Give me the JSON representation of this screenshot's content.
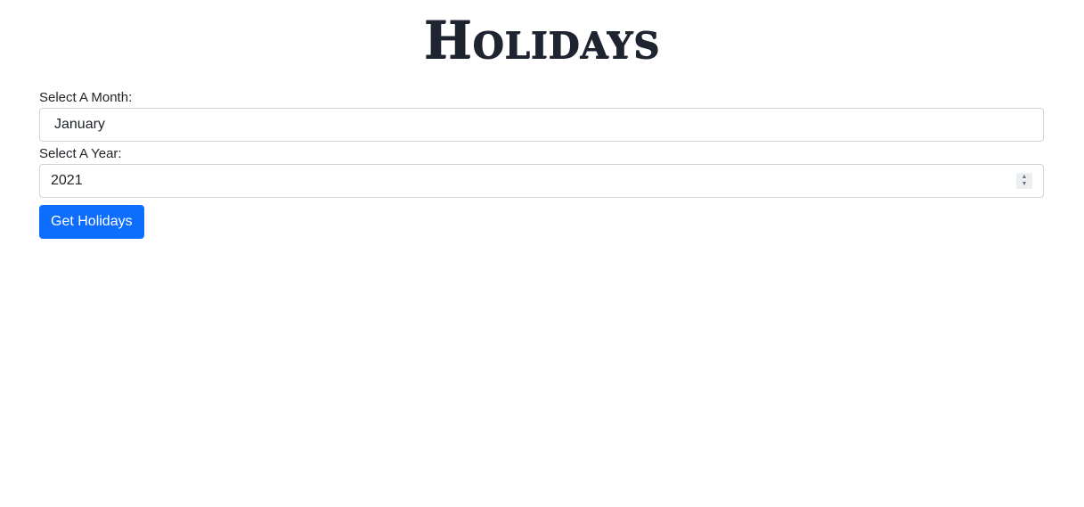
{
  "header": {
    "title": "Holidays"
  },
  "form": {
    "month_label": "Select A Month:",
    "month_value": "January",
    "year_label": "Select A Year:",
    "year_value": "2021",
    "submit_label": "Get Holidays"
  },
  "colors": {
    "button_background": "#0d6efd",
    "field_border": "#ced4da",
    "title_text": "#1f2530"
  },
  "icons": {
    "year_spinner": "stepper-arrows-icon"
  }
}
